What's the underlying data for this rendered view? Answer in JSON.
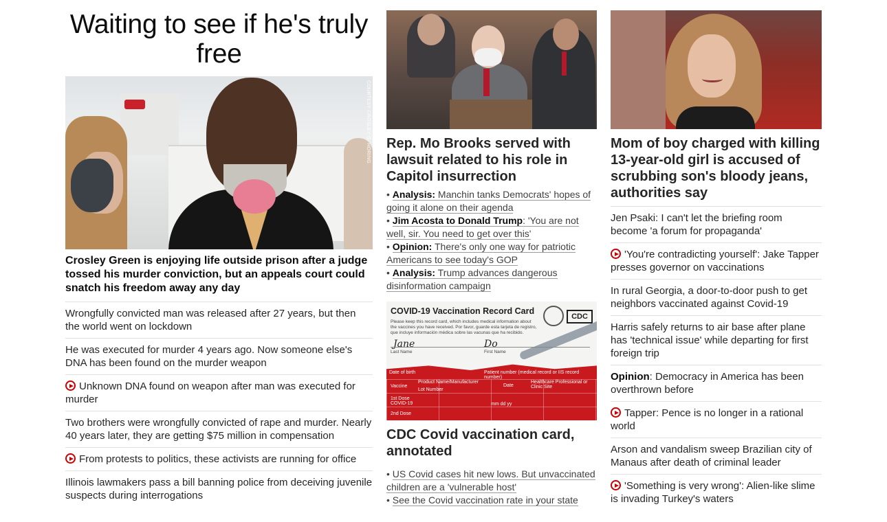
{
  "left": {
    "big_headline": "Waiting to see if he's truly free",
    "photo_credit": "COURTESY CROSLEY G. HORING",
    "hero_caption": "Crosley Green is enjoying life outside prison after a judge tossed his murder conviction, but an appeals court could snatch his freedom away any day",
    "items": [
      {
        "text": "Wrongfully convicted man was released after 27 years, but then the world went on lockdown",
        "video": false
      },
      {
        "text": "He was executed for murder 4 years ago. Now someone else's DNA has been found on the murder weapon",
        "video": false
      },
      {
        "text": "Unknown DNA found on weapon after man was executed for murder",
        "video": true
      },
      {
        "text": "Two brothers were wrongfully convicted of rape and murder. Nearly 40 years later, they are getting $75 million in compensation",
        "video": false
      },
      {
        "text": "From protests to politics, these activists are running for office",
        "video": true
      },
      {
        "text": "Illinois lawmakers pass a bill banning police from deceiving juvenile suspects during interrogations",
        "video": false
      }
    ]
  },
  "middle": {
    "story1": {
      "headline": "Rep. Mo Brooks served with lawsuit related to his role in Capitol insurrection",
      "bullets": [
        {
          "prefix": "Analysis:",
          "text": " Manchin tanks Democrats' hopes of going it alone on their agenda"
        },
        {
          "prefix": "Jim Acosta to Donald Trump",
          "text": ": 'You are not well, sir. You need to get over this'"
        },
        {
          "prefix": "Opinion:",
          "text": " There's only one way for patriotic Americans to see today's GOP"
        },
        {
          "prefix": "Analysis:",
          "text": " Trump advances dangerous disinformation campaign"
        }
      ]
    },
    "card": {
      "title": "COVID-19 Vaccination Record Card",
      "fine_print": "Please keep this record card, which includes medical information about the vaccines you have received. Por favor, guarde esta tarjeta de registro, que incluye información médica sobre las vacunas que ha recibido.",
      "logo": "CDC",
      "last_name_label": "Last Name",
      "first_name_label": "First Name",
      "sig_last": "Jane",
      "sig_first": "Do",
      "dob_label": "Date of birth",
      "patient_label": "Patient number (medical record or IIS record number)",
      "col_vaccine": "Vaccine",
      "col_product": "Product Name/Manufacturer",
      "col_lot": "Lot Number",
      "col_date": "Date",
      "col_site": "Healthcare Professional or Clinic Site",
      "dose1": "1st Dose COVID-19",
      "dose2": "2nd Dose",
      "date_fmt": "mm dd yy"
    },
    "story2": {
      "headline": "CDC Covid vaccination card, annotated",
      "bullets": [
        "US Covid cases hit new lows. But unvaccinated children are a 'vulnerable host'",
        "See the Covid vaccination rate in your state"
      ]
    }
  },
  "right": {
    "headline": "Mom of boy charged with killing 13-year-old girl is accused of scrubbing son's bloody jeans, authorities say",
    "items": [
      {
        "text": "Jen Psaki: I can't let the briefing room become 'a forum for propaganda'",
        "video": false,
        "prefix": ""
      },
      {
        "text": "'You're contradicting yourself': Jake Tapper presses governor on vaccinations",
        "video": true,
        "prefix": ""
      },
      {
        "text": "In rural Georgia, a door-to-door push to get neighbors vaccinated against Covid-19",
        "video": false,
        "prefix": ""
      },
      {
        "text": "Harris safely returns to air base after plane has 'technical issue' while departing for first foreign trip",
        "video": false,
        "prefix": ""
      },
      {
        "text": ": Democracy in America has been overthrown before",
        "video": false,
        "prefix": "Opinion"
      },
      {
        "text": "Tapper: Pence is no longer in a rational world",
        "video": true,
        "prefix": ""
      },
      {
        "text": "Arson and vandalism sweep Brazilian city of Manaus after death of criminal leader",
        "video": false,
        "prefix": ""
      },
      {
        "text": "'Something is very wrong': Alien-like slime is invading Turkey's waters",
        "video": true,
        "prefix": ""
      }
    ]
  },
  "colors": {
    "video_red": "#cc0000",
    "divider": "#e1e1e1",
    "text": "#262626"
  }
}
